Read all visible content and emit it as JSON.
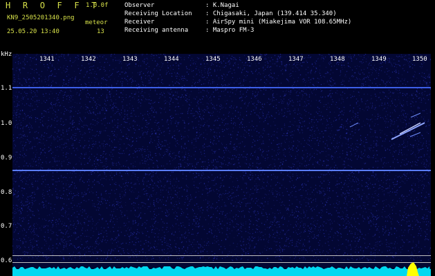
{
  "header": {
    "app_title": "H R O F F T",
    "version": "1.0.0f",
    "filename": "KN9_2505201340.png",
    "datetime": "25.05.20 13:40",
    "meteor_label": "meteor",
    "meteor_count": "13"
  },
  "info": {
    "observer_label": "Observer",
    "observer_value": ": K.Nagai",
    "location_label": "Receiving Location",
    "location_value": ": Chigasaki, Japan (139.414 35.340)",
    "receiver_label": "Receiver",
    "receiver_value": ": AirSpy mini (Miakejima VOR 108.65MHz)",
    "antenna_label": "Receiving antenna",
    "antenna_value": ": Maspro FM-3"
  },
  "axes": {
    "y_unit": "kHz",
    "y_ticks": [
      "1.1",
      "1.0",
      "0.9",
      "0.8",
      "0.7",
      "0.6"
    ],
    "x_ticks": [
      "1341",
      "1342",
      "1343",
      "1344",
      "1345",
      "1346",
      "1347",
      "1348",
      "1349",
      "1350"
    ]
  },
  "colors": {
    "header_text": "#d8e24a",
    "info_text": "#ffffff",
    "background": "#000000",
    "plot_bg": "#030733",
    "carrier_line": "#5a7dff",
    "bottom_band": "#00d8f0",
    "burst": "#ffff00"
  }
}
